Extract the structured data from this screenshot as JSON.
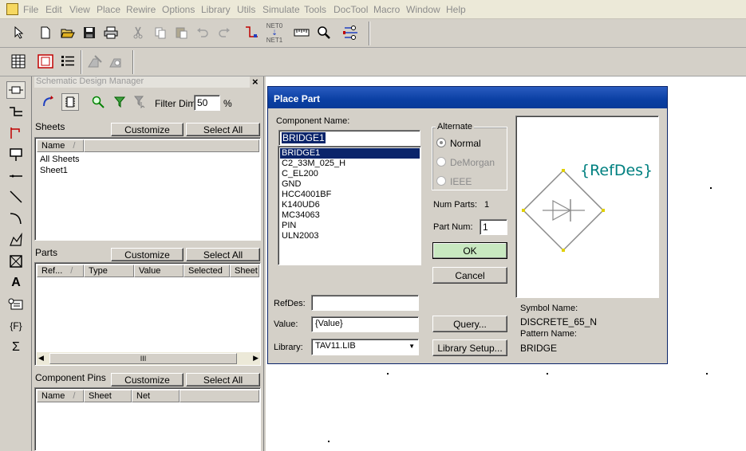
{
  "menu": {
    "items": [
      "File",
      "Edit",
      "View",
      "Place",
      "Rewire",
      "Options",
      "Library",
      "Utils",
      "Simulate",
      "Tools",
      "DocTool",
      "Macro",
      "Window",
      "Help"
    ]
  },
  "toolbar": {
    "net_label_top": "NET0",
    "net_label_bottom": "NET1"
  },
  "left_tools": [
    "place-part-icon",
    "place-bus-icon",
    "place-port-icon",
    "place-pin-icon",
    "place-wire-icon",
    "line-icon",
    "arc-icon",
    "polygon-icon",
    "rectangle-icon",
    "text-icon",
    "field-icon",
    "fields-icon",
    "sigma-icon"
  ],
  "sdm": {
    "title": "Schematic Design Manager",
    "close": "×",
    "filter_label": "Filter Dim:",
    "filter_value": "50",
    "filter_unit": "%",
    "sheets": {
      "label": "Sheets",
      "customize": "Customize",
      "select_all": "Select All",
      "col_name": "Name",
      "col_sort": "/",
      "rows": [
        "All Sheets",
        "Sheet1"
      ]
    },
    "parts": {
      "label": "Parts",
      "customize": "Customize",
      "select_all": "Select All",
      "columns": [
        "Ref...",
        "/",
        "Type",
        "Value",
        "Selected",
        "Sheet"
      ],
      "scroll_grip": "III"
    },
    "pins": {
      "label": "Component Pins",
      "customize": "Customize",
      "select_all": "Select All",
      "columns": [
        "Name",
        "/",
        "Sheet",
        "Net"
      ]
    }
  },
  "dialog": {
    "title": "Place Part",
    "component_name_label": "Component Name:",
    "component_name_value": "BRIDGE1",
    "components": [
      "BRIDGE1",
      "C2_33M_025_H",
      "C_EL200",
      "GND",
      "HCC4001BF",
      "K140UD6",
      "MC34063",
      "PIN",
      "ULN2003"
    ],
    "selected_index": 0,
    "alternate": {
      "label": "Alternate",
      "options": [
        "Normal",
        "DeMorgan",
        "IEEE"
      ],
      "selected": "Normal"
    },
    "num_parts_label": "Num Parts:",
    "num_parts_value": "1",
    "part_num_label": "Part Num:",
    "part_num_value": "1",
    "ok": "OK",
    "cancel": "Cancel",
    "refdes_label": "RefDes:",
    "refdes_value": "",
    "value_label": "Value:",
    "value_value": "{Value}",
    "library_label": "Library:",
    "library_value": "TAV11.LIB",
    "query": "Query...",
    "library_setup": "Library Setup...",
    "preview_refdes": "{RefDes}",
    "symbol_name_label": "Symbol Name:",
    "symbol_name_value": "DISCRETE_65_N",
    "pattern_name_label": "Pattern Name:",
    "pattern_name_value": "BRIDGE",
    "colors": {
      "title_bar": "#0a3fa3",
      "selection": "#0a246a",
      "refdes_text": "#008080",
      "symbol_outline": "#8a8a8a",
      "pin_marker": "#e0d000"
    }
  }
}
